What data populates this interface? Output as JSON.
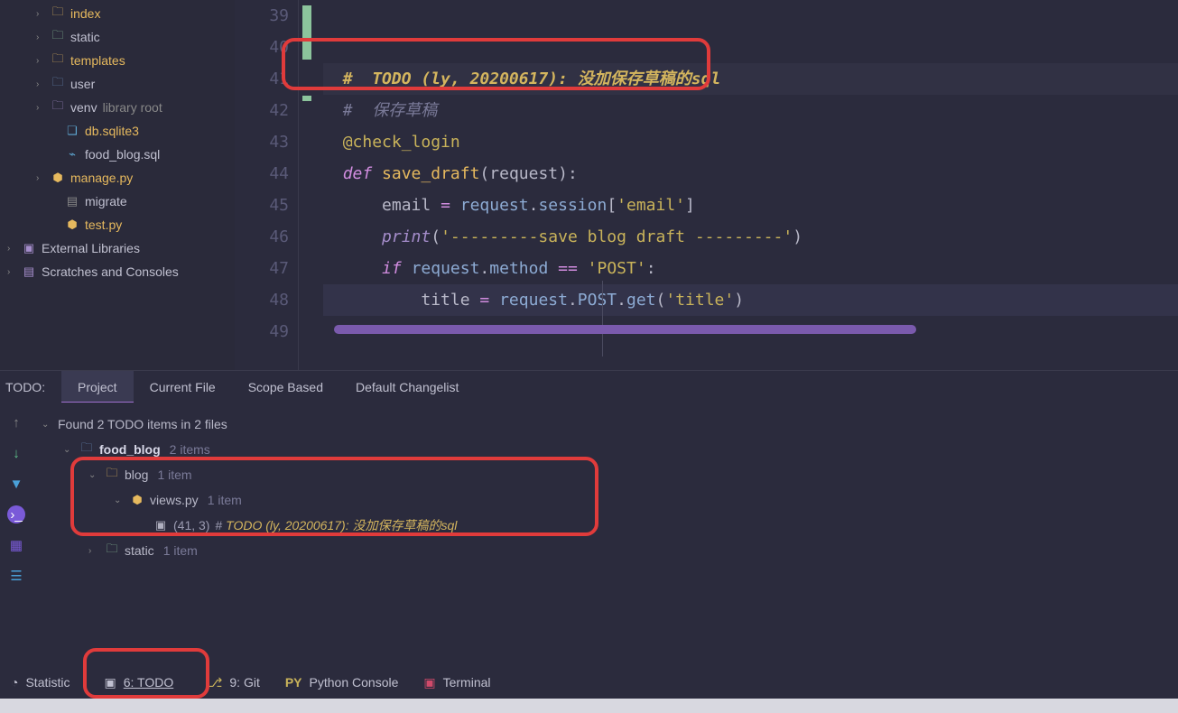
{
  "tree": {
    "items": [
      {
        "indent": 40,
        "chev": "›",
        "icon": "folder-icon",
        "glyph": "🗀",
        "label": "index",
        "cls": "orange"
      },
      {
        "indent": 40,
        "chev": "›",
        "icon": "folder-green",
        "glyph": "🗀",
        "label": "static",
        "cls": ""
      },
      {
        "indent": 40,
        "chev": "›",
        "icon": "folder-icon",
        "glyph": "🗀",
        "label": "templates",
        "cls": "orange"
      },
      {
        "indent": 40,
        "chev": "›",
        "icon": "folder-blue",
        "glyph": "🗀",
        "label": "user",
        "cls": ""
      },
      {
        "indent": 40,
        "chev": "›",
        "icon": "lib-icon",
        "glyph": "🗀",
        "label": "venv",
        "cls": "",
        "suffix": "library root"
      },
      {
        "indent": 56,
        "chev": "",
        "icon": "db-icon",
        "glyph": "❏",
        "label": "db.sqlite3",
        "cls": "orange"
      },
      {
        "indent": 56,
        "chev": "",
        "icon": "db-icon",
        "glyph": "⌁",
        "label": "food_blog.sql",
        "cls": ""
      },
      {
        "indent": 40,
        "chev": "›",
        "icon": "py-icon",
        "glyph": "⬢",
        "label": "manage.py",
        "cls": "orange"
      },
      {
        "indent": 56,
        "chev": "",
        "icon": "txt-icon",
        "glyph": "▤",
        "label": "migrate",
        "cls": ""
      },
      {
        "indent": 56,
        "chev": "",
        "icon": "py-icon",
        "glyph": "⬢",
        "label": "test.py",
        "cls": "orange"
      },
      {
        "indent": 8,
        "chev": "›",
        "icon": "lib-icon",
        "glyph": "▣",
        "label": "External Libraries",
        "cls": ""
      },
      {
        "indent": 8,
        "chev": "›",
        "icon": "lib-icon",
        "glyph": "▤",
        "label": "Scratches and Consoles",
        "cls": ""
      }
    ]
  },
  "editor": {
    "lines": [
      "39",
      "40",
      "41",
      "42",
      "43",
      "44",
      "45",
      "46",
      "47",
      "48",
      "49"
    ],
    "todo_comment": "#  TODO (ly, 20200617): 没加保存草稿的sql",
    "save_comment": "#  保存草稿",
    "decorator": "@check_login",
    "def_kw": "def",
    "fn_name": "save_draft",
    "param": "request",
    "email_assign_lhs": "email",
    "email_rhs_obj": "request",
    "email_rhs_attr": "session",
    "email_key": "'email'",
    "print_builtin": "print",
    "print_arg": "'---------save blog draft ---------'",
    "if_kw": "if",
    "if_obj": "request",
    "if_attr": "method",
    "if_eq": "==",
    "if_val": "'POST'",
    "title_lhs": "title",
    "title_obj": "request",
    "title_attr1": "POST",
    "title_attr2": "get",
    "title_arg": "'title'"
  },
  "todo_bar": {
    "label": "TODO:",
    "tabs": [
      "Project",
      "Current File",
      "Scope Based",
      "Default Changelist"
    ]
  },
  "todo_panel": {
    "summary": "Found 2 TODO items in 2 files",
    "root_folder": "food_blog",
    "root_count": "2 items",
    "blog_folder": "blog",
    "blog_count": "1 item",
    "views_file": "views.py",
    "views_count": "1 item",
    "item_loc": "(41, 3)",
    "item_hash": "#",
    "item_text": "TODO (ly, 20200617): 没加保存草稿的sql",
    "static_folder": "static",
    "static_count": "1 item"
  },
  "statusbar": {
    "statistic": "Statistic",
    "todo": "6: TODO",
    "git": "9: Git",
    "pyconsole": "Python Console",
    "terminal": "Terminal"
  }
}
